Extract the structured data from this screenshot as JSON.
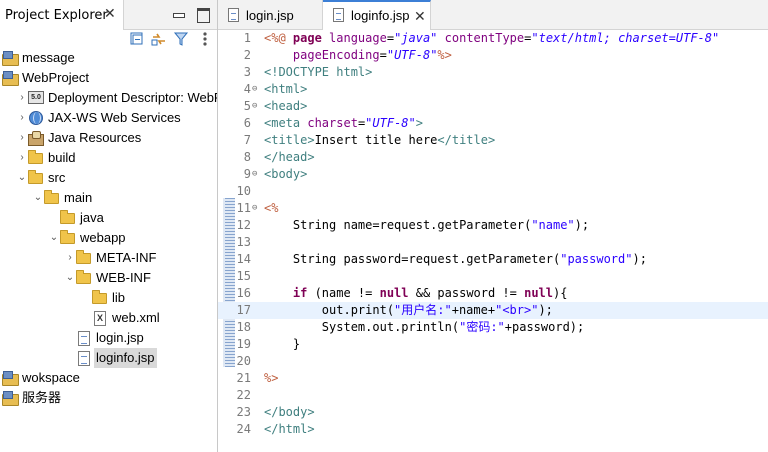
{
  "explorer": {
    "tab_label": "Project Explorer",
    "close_glyph": "✕",
    "toolbar_icons": [
      "collapse-all-icon",
      "link-with-editor-icon",
      "filter-icon",
      "view-menu-icon"
    ],
    "tree": [
      {
        "label": "message",
        "icon": "project-icon",
        "indent": 0,
        "chev": ""
      },
      {
        "label": "WebProject",
        "icon": "project-icon",
        "indent": 0,
        "chev": ""
      },
      {
        "label": "Deployment Descriptor: WebProject",
        "icon": "deployment-descriptor-icon",
        "indent": 1,
        "chev": "›"
      },
      {
        "label": "JAX-WS Web Services",
        "icon": "web-services-icon",
        "indent": 1,
        "chev": "›"
      },
      {
        "label": "Java Resources",
        "icon": "java-resources-icon",
        "indent": 1,
        "chev": "›"
      },
      {
        "label": "build",
        "icon": "folder-icon",
        "indent": 1,
        "chev": "›"
      },
      {
        "label": "src",
        "icon": "folder-icon",
        "indent": 1,
        "chev": "⌄"
      },
      {
        "label": "main",
        "icon": "folder-icon",
        "indent": 2,
        "chev": "⌄"
      },
      {
        "label": "java",
        "icon": "folder-icon",
        "indent": 3,
        "chev": ""
      },
      {
        "label": "webapp",
        "icon": "folder-icon",
        "indent": 3,
        "chev": "⌄"
      },
      {
        "label": "META-INF",
        "icon": "folder-icon",
        "indent": 4,
        "chev": "›"
      },
      {
        "label": "WEB-INF",
        "icon": "folder-icon",
        "indent": 4,
        "chev": "⌄"
      },
      {
        "label": "lib",
        "icon": "folder-icon",
        "indent": 5,
        "chev": ""
      },
      {
        "label": "web.xml",
        "icon": "xml-file-icon",
        "indent": 5,
        "chev": ""
      },
      {
        "label": "login.jsp",
        "icon": "jsp-file-icon",
        "indent": 4,
        "chev": ""
      },
      {
        "label": "loginfo.jsp",
        "icon": "jsp-file-icon",
        "indent": 4,
        "chev": "",
        "selected": true
      },
      {
        "label": "wokspace",
        "icon": "project-icon",
        "indent": 0,
        "chev": ""
      },
      {
        "label": "服务器",
        "icon": "project-icon",
        "indent": 0,
        "chev": ""
      }
    ]
  },
  "editor": {
    "tabs": [
      {
        "label": "login.jsp",
        "active": false
      },
      {
        "label": "loginfo.jsp",
        "active": true
      }
    ],
    "close_glyph": "✕",
    "current_line": 17,
    "lines": [
      {
        "n": "1",
        "fold": "",
        "tokens": [
          [
            "jsp",
            "<%@ "
          ],
          [
            "kw",
            "page "
          ],
          [
            "attr",
            "language"
          ],
          [
            "plain",
            "="
          ],
          [
            "str",
            "\"java\""
          ],
          [
            "plain",
            " "
          ],
          [
            "attr",
            "contentType"
          ],
          [
            "plain",
            "="
          ],
          [
            "str",
            "\"text/html; charset=UTF-8\""
          ]
        ]
      },
      {
        "n": "2",
        "fold": "",
        "tokens": [
          [
            "plain",
            "    "
          ],
          [
            "attr",
            "pageEncoding"
          ],
          [
            "plain",
            "="
          ],
          [
            "str",
            "\"UTF-8\""
          ],
          [
            "jsp",
            "%>"
          ]
        ]
      },
      {
        "n": "3",
        "fold": "",
        "tokens": [
          [
            "doc",
            "<!DOCTYPE html>"
          ]
        ]
      },
      {
        "n": "4",
        "fold": "⊖",
        "tokens": [
          [
            "tag",
            "<html>"
          ]
        ]
      },
      {
        "n": "5",
        "fold": "⊖",
        "tokens": [
          [
            "tag",
            "<head>"
          ]
        ]
      },
      {
        "n": "6",
        "fold": "",
        "tokens": [
          [
            "tag",
            "<meta "
          ],
          [
            "attr",
            "charset"
          ],
          [
            "plain",
            "="
          ],
          [
            "str",
            "\"UTF-8\""
          ],
          [
            "tag",
            ">"
          ]
        ]
      },
      {
        "n": "7",
        "fold": "",
        "tokens": [
          [
            "tag",
            "<title>"
          ],
          [
            "plain",
            "Insert title here"
          ],
          [
            "tag",
            "</title>"
          ]
        ]
      },
      {
        "n": "8",
        "fold": "",
        "tokens": [
          [
            "tag",
            "</head>"
          ]
        ]
      },
      {
        "n": "9",
        "fold": "⊖",
        "tokens": [
          [
            "tag",
            "<body>"
          ]
        ]
      },
      {
        "n": "10",
        "fold": "",
        "tokens": []
      },
      {
        "n": "11",
        "fold": "⊖",
        "tokens": [
          [
            "jsp",
            "<%"
          ]
        ]
      },
      {
        "n": "12",
        "fold": "",
        "tokens": [
          [
            "plain",
            "    String name=request.getParameter("
          ],
          [
            "str2",
            "\"name\""
          ],
          [
            "plain",
            ");"
          ]
        ]
      },
      {
        "n": "13",
        "fold": "",
        "tokens": []
      },
      {
        "n": "14",
        "fold": "",
        "tokens": [
          [
            "plain",
            "    String password=request.getParameter("
          ],
          [
            "str2",
            "\"password\""
          ],
          [
            "plain",
            ");"
          ]
        ]
      },
      {
        "n": "15",
        "fold": "",
        "tokens": []
      },
      {
        "n": "16",
        "fold": "",
        "tokens": [
          [
            "plain",
            "    "
          ],
          [
            "kw",
            "if"
          ],
          [
            "plain",
            " (name != "
          ],
          [
            "kw",
            "null"
          ],
          [
            "plain",
            " && password != "
          ],
          [
            "kw",
            "null"
          ],
          [
            "plain",
            "){"
          ]
        ]
      },
      {
        "n": "17",
        "fold": "",
        "tokens": [
          [
            "plain",
            "        out.print("
          ],
          [
            "str2",
            "\"用户名:\""
          ],
          [
            "plain",
            "+name+"
          ],
          [
            "str2",
            "\"<br>\""
          ],
          [
            "plain",
            ");"
          ]
        ]
      },
      {
        "n": "18",
        "fold": "",
        "tokens": [
          [
            "plain",
            "        System."
          ],
          [
            "plain",
            "out"
          ],
          [
            "plain",
            ".println("
          ],
          [
            "str2",
            "\"密码:\""
          ],
          [
            "plain",
            "+password);"
          ]
        ]
      },
      {
        "n": "19",
        "fold": "",
        "tokens": [
          [
            "plain",
            "    }"
          ]
        ]
      },
      {
        "n": "20",
        "fold": "",
        "tokens": []
      },
      {
        "n": "21",
        "fold": "",
        "tokens": [
          [
            "jsp",
            "%>"
          ]
        ]
      },
      {
        "n": "22",
        "fold": "",
        "tokens": []
      },
      {
        "n": "23",
        "fold": "",
        "tokens": [
          [
            "tag",
            "</body>"
          ]
        ]
      },
      {
        "n": "24",
        "fold": "",
        "tokens": [
          [
            "tag",
            "</html>"
          ]
        ]
      }
    ]
  }
}
